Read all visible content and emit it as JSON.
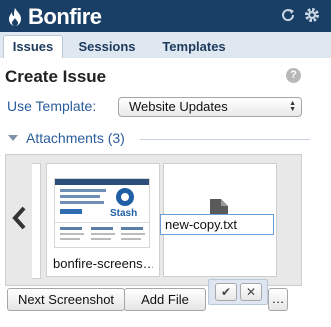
{
  "app": {
    "name": "Bonfire"
  },
  "tabs": [
    {
      "label": "Issues"
    },
    {
      "label": "Sessions"
    },
    {
      "label": "Templates"
    }
  ],
  "page": {
    "title": "Create Issue",
    "help_glyph": "?"
  },
  "template": {
    "label": "Use Template:",
    "selected": "Website Updates"
  },
  "attachments": {
    "label": "Attachments (3)",
    "items": [
      {
        "name": "bonfire-screens…",
        "type": "screenshot",
        "preview_text": "Stash"
      },
      {
        "name": "new-copy.txt",
        "type": "text-file"
      }
    ]
  },
  "buttons": {
    "next_screenshot": "Next Screenshot",
    "add_file": "Add File",
    "more": "…"
  },
  "colors": {
    "header": "#1a3f66",
    "accent": "#2a5d9c"
  }
}
